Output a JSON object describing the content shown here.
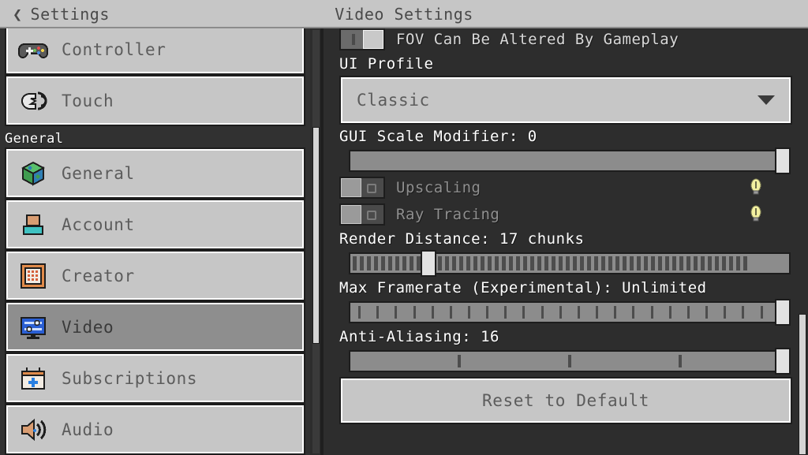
{
  "header": {
    "back_label": "Settings",
    "back_icon": "chevron-left-icon",
    "title": "Video Settings"
  },
  "sidebar": {
    "groups": [
      {
        "label": "",
        "items": [
          {
            "label": "Controller",
            "icon": "gamepad-icon",
            "selected": false
          },
          {
            "label": "Touch",
            "icon": "touch-hand-icon",
            "selected": false
          }
        ]
      },
      {
        "label": "General",
        "items": [
          {
            "label": "General",
            "icon": "globe-cube-icon",
            "selected": false
          },
          {
            "label": "Account",
            "icon": "account-person-icon",
            "selected": false
          },
          {
            "label": "Creator",
            "icon": "creator-grid-icon",
            "selected": false
          },
          {
            "label": "Video",
            "icon": "monitor-sliders-icon",
            "selected": true
          },
          {
            "label": "Subscriptions",
            "icon": "calendar-plus-icon",
            "selected": false
          },
          {
            "label": "Audio",
            "icon": "speaker-icon",
            "selected": false
          }
        ]
      }
    ]
  },
  "panel": {
    "items": [
      {
        "type": "toggle",
        "label": "FOV Can Be Altered By Gameplay",
        "state": "on",
        "enabled": true,
        "info": false
      },
      {
        "type": "dropdown",
        "label": "UI Profile",
        "value": "Classic",
        "caret_icon": "chevron-down-icon"
      },
      {
        "type": "slider",
        "label": "GUI Scale Modifier: 0",
        "value": 0,
        "percent": 100,
        "ticks": 0
      },
      {
        "type": "toggle",
        "label": "Upscaling",
        "state": "off",
        "enabled": false,
        "info": true,
        "info_icon": "lightbulb-icon"
      },
      {
        "type": "toggle",
        "label": "Ray Tracing",
        "state": "off",
        "enabled": false,
        "info": true,
        "info_icon": "lightbulb-icon"
      },
      {
        "type": "slider",
        "label": "Render Distance: 17 chunks",
        "value": 17,
        "percent": 17,
        "ticks": 56
      },
      {
        "type": "slider",
        "label": "Max Framerate (Experimental): Unlimited",
        "value": "Unlimited",
        "percent": 100,
        "ticks": 24
      },
      {
        "type": "slider",
        "label": "Anti-Aliasing: 16",
        "value": 16,
        "percent": 100,
        "ticks": 3
      },
      {
        "type": "button",
        "label": "Reset to Default"
      }
    ]
  },
  "colors": {
    "topbar_bg": "#c6c6c6",
    "panel_bg": "#2d2d2d",
    "sidebar_bg": "#313131",
    "row_bg": "#c6c6c6",
    "row_selected_bg": "#8e8e8e",
    "text_light": "#ffffff",
    "text_dark": "#5c5c5c",
    "bulb_yellow": "#f2f0a0",
    "scrollbar_thumb": "#d4d4d4"
  }
}
